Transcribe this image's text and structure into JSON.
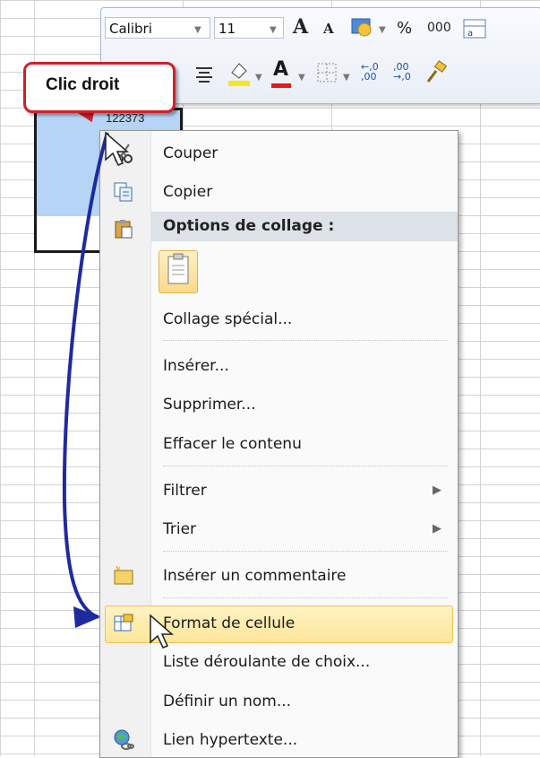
{
  "mini_toolbar": {
    "font_name": "Calibri",
    "font_size": "11",
    "grow_font": "A",
    "shrink_font": "A",
    "percent": "%",
    "thousands": "000",
    "increase_decimal": "←,0\n,00",
    "decrease_decimal": ",00\n→,0",
    "font_color_letter": "A"
  },
  "cell": {
    "value": "122373"
  },
  "callout": {
    "label": "Clic droit"
  },
  "menu": {
    "items": [
      {
        "label": "Couper",
        "icon": "scissors-icon"
      },
      {
        "label": "Copier",
        "icon": "copy-icon"
      },
      {
        "label": "Options de collage :",
        "icon": "paste-options-icon"
      },
      {
        "label": "Collage spécial..."
      },
      {
        "label": "Insérer..."
      },
      {
        "label": "Supprimer..."
      },
      {
        "label": "Effacer le contenu"
      },
      {
        "label": "Filtrer",
        "submenu": "▶"
      },
      {
        "label": "Trier",
        "submenu": "▶"
      },
      {
        "label": "Insérer un commentaire",
        "icon": "comment-icon"
      },
      {
        "label": "Format de cellule",
        "icon": "format-cells-icon"
      },
      {
        "label": "Liste déroulante de choix..."
      },
      {
        "label": "Définir un nom..."
      },
      {
        "label": "Lien hypertexte...",
        "icon": "hyperlink-icon"
      }
    ]
  },
  "colors": {
    "accent_arrow": "#1f2aa0",
    "callout_border": "#d0202a",
    "highlight": "#fde59a",
    "selection": "#b6d4f5"
  }
}
